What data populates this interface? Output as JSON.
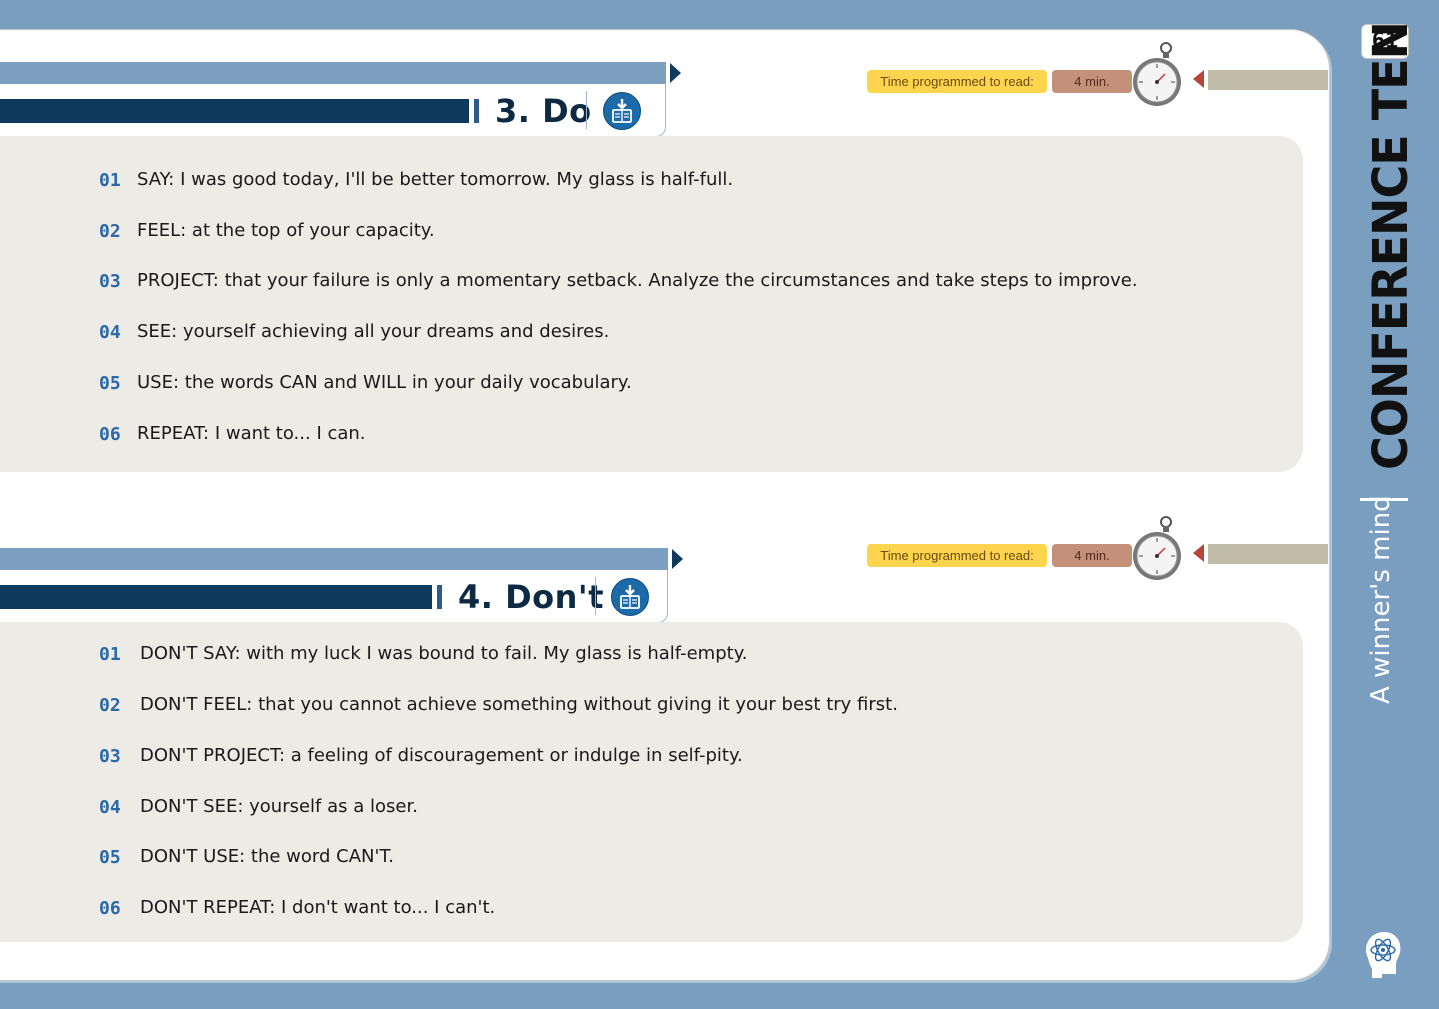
{
  "page_number": "61",
  "sidebar": {
    "title": "CONFERENCE TEN",
    "subtitle": "A winner's mind"
  },
  "colors": {
    "background": "#7a9ec0",
    "number_blue": "#2a68a8",
    "dark_band": "#0d3a5c",
    "time_label_bg": "#fcd44e",
    "time_value_bg": "#c4907a"
  },
  "sections": [
    {
      "title": "3. Do",
      "time_label": "Time programmed to read:",
      "time_value": "4 min.",
      "items": [
        {
          "num": "01",
          "text": "SAY: I was good today, I'll be better tomorrow. My glass is half-full."
        },
        {
          "num": "02",
          "text": "FEEL: at the top of your capacity."
        },
        {
          "num": "03",
          "text": "PROJECT: that your failure is only a momentary setback. Analyze the circumstances and take steps to improve."
        },
        {
          "num": "04",
          "text": "SEE: yourself achieving all your dreams and desires."
        },
        {
          "num": "05",
          "text": "USE: the words CAN and WILL in your daily vocabulary."
        },
        {
          "num": "06",
          "text": "REPEAT: I want to... I can."
        }
      ]
    },
    {
      "title": "4. Don't",
      "time_label": "Time programmed to read:",
      "time_value": "4 min.",
      "items": [
        {
          "num": "01",
          "text": "DON'T SAY: with my luck I was bound to fail. My glass is half-empty."
        },
        {
          "num": "02",
          "text": "DON'T FEEL: that you cannot achieve something without giving it your best try first."
        },
        {
          "num": "03",
          "text": "DON'T PROJECT: a feeling of discouragement or indulge in self-pity."
        },
        {
          "num": "04",
          "text": "DON'T SEE: yourself as a loser."
        },
        {
          "num": "05",
          "text": "DON'T USE: the word CAN'T."
        },
        {
          "num": "06",
          "text": "DON'T REPEAT: I don't want to... I can't."
        }
      ]
    }
  ]
}
